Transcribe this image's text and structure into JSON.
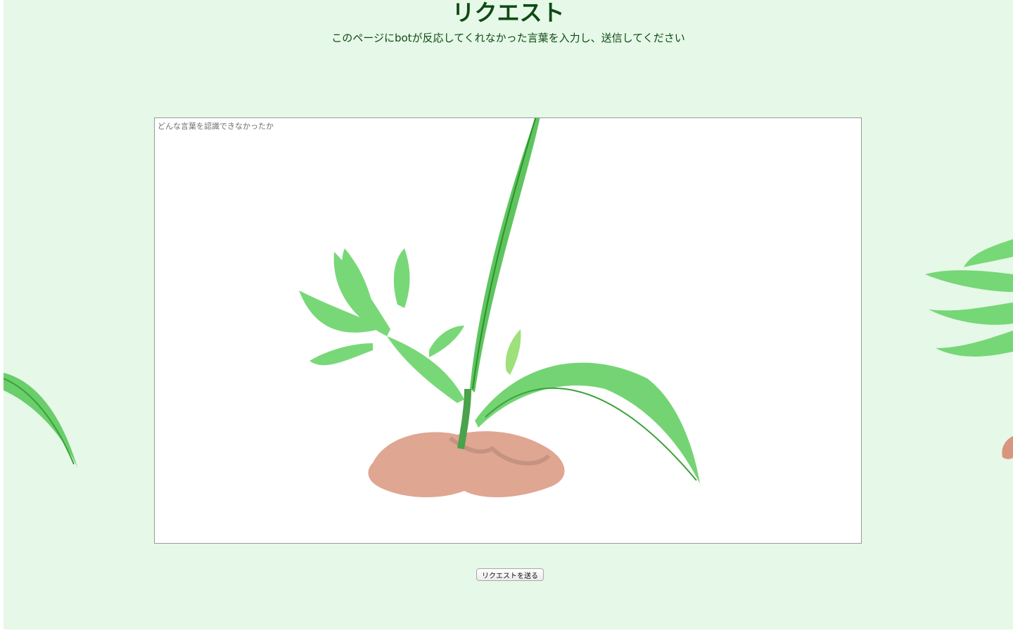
{
  "header": {
    "title": "リクエスト",
    "subtitle": "このページにbotが反応してくれなかった言葉を入力し、送信してください"
  },
  "form": {
    "textarea_placeholder": "どんな言葉を認識できなかったか",
    "textarea_value": "",
    "submit_label": "リクエストを送る"
  },
  "decoration": {
    "illustration": "watercolor-sprout-illustration",
    "colors": {
      "page_background": "#e6f8e8",
      "heading": "#0f4a14",
      "leaf": "#5cc95c",
      "soil": "#d9967f"
    }
  }
}
